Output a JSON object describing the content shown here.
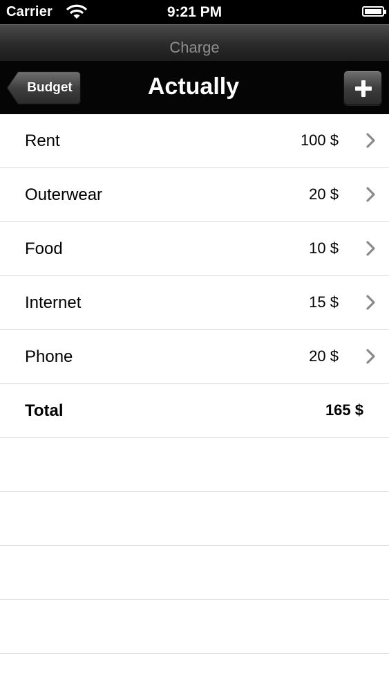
{
  "status_bar": {
    "carrier": "Carrier",
    "time": "9:21 PM",
    "icons": [
      "wifi-icon",
      "battery-icon"
    ]
  },
  "prompt": "Charge",
  "nav": {
    "back_label": "Budget",
    "title": "Actually",
    "add_icon": "plus-icon"
  },
  "items": [
    {
      "label": "Rent",
      "value": "100 $"
    },
    {
      "label": "Outerwear",
      "value": "20 $"
    },
    {
      "label": "Food",
      "value": "10 $"
    },
    {
      "label": "Internet",
      "value": "15 $"
    },
    {
      "label": "Phone",
      "value": "20 $"
    }
  ],
  "total": {
    "label": "Total",
    "value": "165 $"
  },
  "colors": {
    "status_bar": "#000000",
    "nav_bar": "#050505",
    "chevron": "#8a8a8a",
    "separator": "#dcdcdc"
  }
}
